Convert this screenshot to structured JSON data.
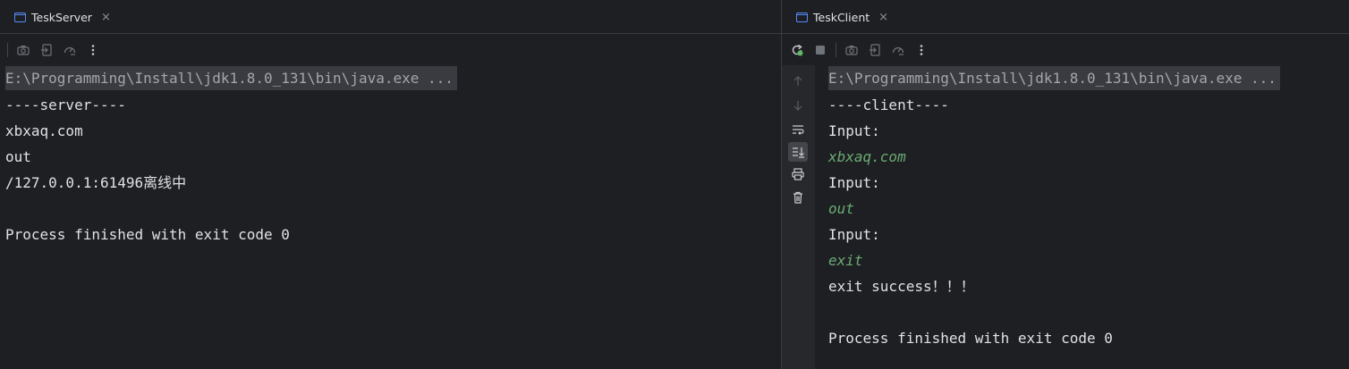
{
  "left": {
    "tab": {
      "title": "TeskServer",
      "close": "×"
    },
    "console_lines": [
      {
        "text": "E:\\Programming\\Install\\jdk1.8.0_131\\bin\\java.exe ...",
        "kind": "cmd"
      },
      {
        "text": "----server----",
        "kind": "out"
      },
      {
        "text": "xbxaq.com",
        "kind": "out"
      },
      {
        "text": "out",
        "kind": "out"
      },
      {
        "text": "/127.0.0.1:61496离线中",
        "kind": "out"
      },
      {
        "text": "",
        "kind": "out"
      },
      {
        "text": "Process finished with exit code 0",
        "kind": "out"
      }
    ]
  },
  "right": {
    "tab": {
      "title": "TeskClient",
      "close": "×"
    },
    "console_lines": [
      {
        "text": "E:\\Programming\\Install\\jdk1.8.0_131\\bin\\java.exe ...",
        "kind": "cmd"
      },
      {
        "text": "----client----",
        "kind": "out"
      },
      {
        "text": "Input:",
        "kind": "out"
      },
      {
        "text": "xbxaq.com",
        "kind": "user"
      },
      {
        "text": "Input:",
        "kind": "out"
      },
      {
        "text": "out",
        "kind": "user"
      },
      {
        "text": "Input:",
        "kind": "out"
      },
      {
        "text": "exit",
        "kind": "user"
      },
      {
        "text": "exit success！！！",
        "kind": "out"
      },
      {
        "text": "",
        "kind": "out"
      },
      {
        "text": "Process finished with exit code 0",
        "kind": "out"
      }
    ]
  },
  "icons": {
    "left_toolbar": [
      "camera-icon",
      "restore-layout-icon",
      "speedometer-icon",
      "more-options-icon"
    ],
    "right_toolbar": [
      "rerun-icon",
      "stop-icon",
      "camera-icon",
      "restore-layout-icon",
      "speedometer-icon",
      "more-options-icon"
    ],
    "gutter": [
      "up-arrow-icon",
      "down-arrow-icon",
      "soft-wrap-icon",
      "scroll-to-end-icon",
      "print-icon",
      "trash-icon"
    ]
  },
  "colors": {
    "background": "#1e1f22",
    "command_line_bg": "#393b40",
    "user_input": "#6aab73",
    "rerun_green": "#5fb865",
    "tab_icon_blue": "#548af7"
  }
}
